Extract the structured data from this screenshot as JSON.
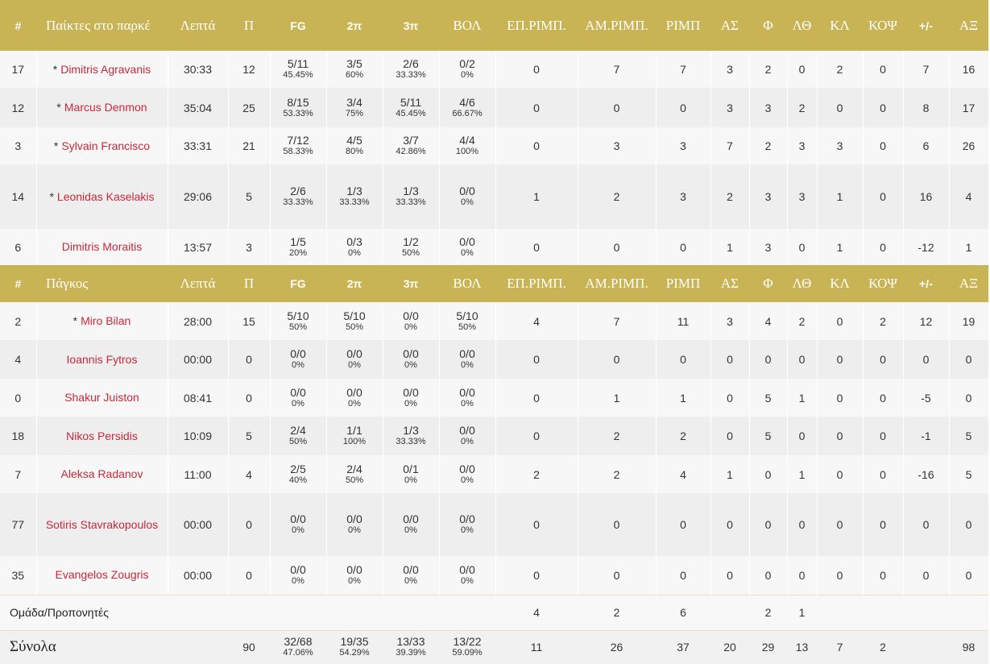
{
  "colors": {
    "header_bg": "#c9b455",
    "player_link": "#c9283a",
    "row_alt": "#eeeeee",
    "row_base": "#f7f7f7"
  },
  "starters_header": {
    "cols": [
      "#",
      "Παίκτες στο παρκέ",
      "Λεπτά",
      "Π",
      "FG",
      "2π",
      "3π",
      "ΒΟΛ",
      "ΕΠ.ΡΙΜΠ.",
      "ΑΜ.ΡΙΜΠ.",
      "ΡΙΜΠ",
      "ΑΣ",
      "Φ",
      "ΛΘ",
      "ΚΛ",
      "ΚΟΨ",
      "+/-",
      "ΑΞ"
    ]
  },
  "bench_header": {
    "cols": [
      "#",
      "Πάγκος",
      "Λεπτά",
      "Π",
      "FG",
      "2π",
      "3π",
      "ΒΟΛ",
      "ΕΠ.ΡΙΜΠ.",
      "ΑΜ.ΡΙΜΠ.",
      "ΡΙΜΠ",
      "ΑΣ",
      "Φ",
      "ΛΘ",
      "ΚΛ",
      "ΚΟΨ",
      "+/-",
      "ΑΞ"
    ]
  },
  "starters": [
    {
      "num": "17",
      "star": "*",
      "name": "Dimitris Agravanis",
      "min": "30:33",
      "pts": "12",
      "fg": "5/11",
      "fg_pct": "45.45%",
      "p2": "3/5",
      "p2_pct": "60%",
      "p3": "2/6",
      "p3_pct": "33.33%",
      "ft": "0/2",
      "ft_pct": "0%",
      "oreb": "0",
      "dreb": "7",
      "reb": "7",
      "ast": "3",
      "pf": "2",
      "to": "0",
      "stl": "2",
      "blk": "0",
      "pm": "7",
      "eff": "16"
    },
    {
      "num": "12",
      "star": "*",
      "name": "Marcus Denmon",
      "min": "35:04",
      "pts": "25",
      "fg": "8/15",
      "fg_pct": "53.33%",
      "p2": "3/4",
      "p2_pct": "75%",
      "p3": "5/11",
      "p3_pct": "45.45%",
      "ft": "4/6",
      "ft_pct": "66.67%",
      "oreb": "0",
      "dreb": "0",
      "reb": "0",
      "ast": "3",
      "pf": "3",
      "to": "2",
      "stl": "0",
      "blk": "0",
      "pm": "8",
      "eff": "17"
    },
    {
      "num": "3",
      "star": "*",
      "name": "Sylvain Francisco",
      "min": "33:31",
      "pts": "21",
      "fg": "7/12",
      "fg_pct": "58.33%",
      "p2": "4/5",
      "p2_pct": "80%",
      "p3": "3/7",
      "p3_pct": "42.86%",
      "ft": "4/4",
      "ft_pct": "100%",
      "oreb": "0",
      "dreb": "3",
      "reb": "3",
      "ast": "7",
      "pf": "2",
      "to": "3",
      "stl": "3",
      "blk": "0",
      "pm": "6",
      "eff": "26"
    },
    {
      "num": "14",
      "star": "*",
      "name": "Leonidas Kaselakis",
      "min": "29:06",
      "pts": "5",
      "fg": "2/6",
      "fg_pct": "33.33%",
      "p2": "1/3",
      "p2_pct": "33.33%",
      "p3": "1/3",
      "p3_pct": "33.33%",
      "ft": "0/0",
      "ft_pct": "0%",
      "oreb": "1",
      "dreb": "2",
      "reb": "3",
      "ast": "2",
      "pf": "3",
      "to": "3",
      "stl": "1",
      "blk": "0",
      "pm": "16",
      "eff": "4"
    },
    {
      "num": "6",
      "star": "",
      "name": "Dimitris Moraitis",
      "min": "13:57",
      "pts": "3",
      "fg": "1/5",
      "fg_pct": "20%",
      "p2": "0/3",
      "p2_pct": "0%",
      "p3": "1/2",
      "p3_pct": "50%",
      "ft": "0/0",
      "ft_pct": "0%",
      "oreb": "0",
      "dreb": "0",
      "reb": "0",
      "ast": "1",
      "pf": "3",
      "to": "0",
      "stl": "1",
      "blk": "0",
      "pm": "-12",
      "eff": "1"
    }
  ],
  "bench": [
    {
      "num": "2",
      "star": "*",
      "name": "Miro Bilan",
      "min": "28:00",
      "pts": "15",
      "fg": "5/10",
      "fg_pct": "50%",
      "p2": "5/10",
      "p2_pct": "50%",
      "p3": "0/0",
      "p3_pct": "0%",
      "ft": "5/10",
      "ft_pct": "50%",
      "oreb": "4",
      "dreb": "7",
      "reb": "11",
      "ast": "3",
      "pf": "4",
      "to": "2",
      "stl": "0",
      "blk": "2",
      "pm": "12",
      "eff": "19"
    },
    {
      "num": "4",
      "star": "",
      "name": "Ioannis Fytros",
      "min": "00:00",
      "pts": "0",
      "fg": "0/0",
      "fg_pct": "0%",
      "p2": "0/0",
      "p2_pct": "0%",
      "p3": "0/0",
      "p3_pct": "0%",
      "ft": "0/0",
      "ft_pct": "0%",
      "oreb": "0",
      "dreb": "0",
      "reb": "0",
      "ast": "0",
      "pf": "0",
      "to": "0",
      "stl": "0",
      "blk": "0",
      "pm": "0",
      "eff": "0"
    },
    {
      "num": "0",
      "star": "",
      "name": "Shakur Juiston",
      "min": "08:41",
      "pts": "0",
      "fg": "0/0",
      "fg_pct": "0%",
      "p2": "0/0",
      "p2_pct": "0%",
      "p3": "0/0",
      "p3_pct": "0%",
      "ft": "0/0",
      "ft_pct": "0%",
      "oreb": "0",
      "dreb": "1",
      "reb": "1",
      "ast": "0",
      "pf": "5",
      "to": "1",
      "stl": "0",
      "blk": "0",
      "pm": "-5",
      "eff": "0"
    },
    {
      "num": "18",
      "star": "",
      "name": "Nikos Persidis",
      "min": "10:09",
      "pts": "5",
      "fg": "2/4",
      "fg_pct": "50%",
      "p2": "1/1",
      "p2_pct": "100%",
      "p3": "1/3",
      "p3_pct": "33.33%",
      "ft": "0/0",
      "ft_pct": "0%",
      "oreb": "0",
      "dreb": "2",
      "reb": "2",
      "ast": "0",
      "pf": "5",
      "to": "0",
      "stl": "0",
      "blk": "0",
      "pm": "-1",
      "eff": "5"
    },
    {
      "num": "7",
      "star": "",
      "name": "Aleksa Radanov",
      "min": "11:00",
      "pts": "4",
      "fg": "2/5",
      "fg_pct": "40%",
      "p2": "2/4",
      "p2_pct": "50%",
      "p3": "0/1",
      "p3_pct": "0%",
      "ft": "0/0",
      "ft_pct": "0%",
      "oreb": "2",
      "dreb": "2",
      "reb": "4",
      "ast": "1",
      "pf": "0",
      "to": "1",
      "stl": "0",
      "blk": "0",
      "pm": "-16",
      "eff": "5"
    },
    {
      "num": "77",
      "star": "",
      "name": "Sotiris Stavrakopoulos",
      "min": "00:00",
      "pts": "0",
      "fg": "0/0",
      "fg_pct": "0%",
      "p2": "0/0",
      "p2_pct": "0%",
      "p3": "0/0",
      "p3_pct": "0%",
      "ft": "0/0",
      "ft_pct": "0%",
      "oreb": "0",
      "dreb": "0",
      "reb": "0",
      "ast": "0",
      "pf": "0",
      "to": "0",
      "stl": "0",
      "blk": "0",
      "pm": "0",
      "eff": "0"
    },
    {
      "num": "35",
      "star": "",
      "name": "Evangelos Zougris",
      "min": "00:00",
      "pts": "0",
      "fg": "0/0",
      "fg_pct": "0%",
      "p2": "0/0",
      "p2_pct": "0%",
      "p3": "0/0",
      "p3_pct": "0%",
      "ft": "0/0",
      "ft_pct": "0%",
      "oreb": "0",
      "dreb": "0",
      "reb": "0",
      "ast": "0",
      "pf": "0",
      "to": "0",
      "stl": "0",
      "blk": "0",
      "pm": "0",
      "eff": "0"
    }
  ],
  "team": {
    "label": "Ομάδα/Προπονητές",
    "oreb": "4",
    "dreb": "2",
    "reb": "6",
    "pf": "2",
    "to": "1"
  },
  "totals": {
    "label": "Σύνολα",
    "pts": "90",
    "fg": "32/68",
    "fg_pct": "47.06%",
    "p2": "19/35",
    "p2_pct": "54.29%",
    "p3": "13/33",
    "p3_pct": "39.39%",
    "ft": "13/22",
    "ft_pct": "59.09%",
    "oreb": "11",
    "dreb": "26",
    "reb": "37",
    "ast": "20",
    "pf": "29",
    "to": "13",
    "stl": "7",
    "blk": "2",
    "eff": "98"
  }
}
